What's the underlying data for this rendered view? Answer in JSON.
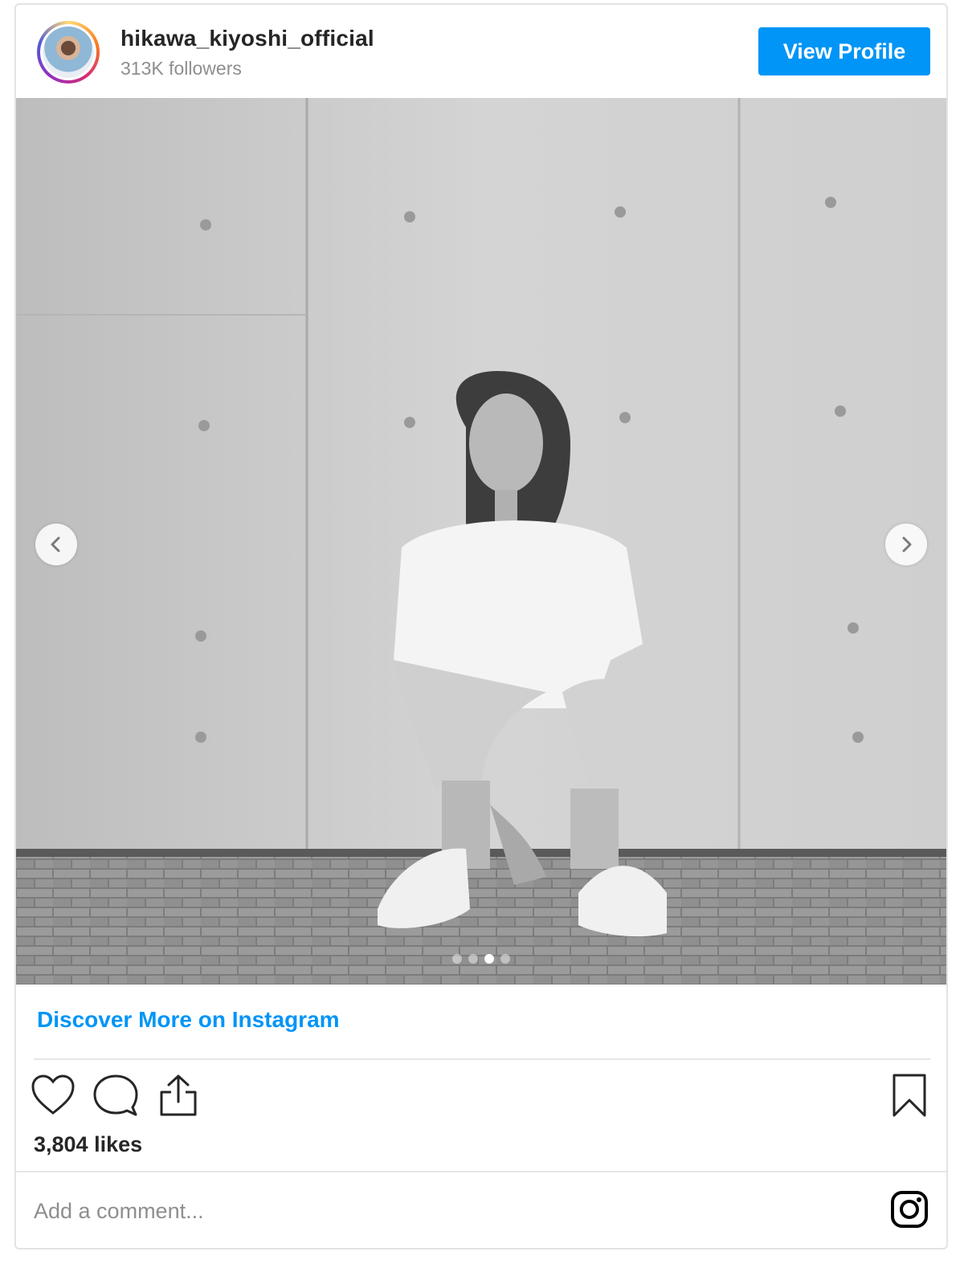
{
  "profile": {
    "username": "hikawa_kiyoshi_official",
    "followers": "313K followers",
    "view_profile_label": "View Profile"
  },
  "carousel": {
    "slide_count": 4,
    "active_index": 2
  },
  "discover_label": "Discover More on Instagram",
  "post": {
    "likes": "3,804 likes"
  },
  "comment": {
    "placeholder": "Add a comment..."
  },
  "icons": {
    "like": "heart-icon",
    "comment": "comment-bubble-icon",
    "share": "share-icon",
    "save": "bookmark-icon",
    "instagram": "instagram-logo-icon"
  },
  "colors": {
    "accent": "#0095f6",
    "text": "#262626",
    "muted": "#8e8e8e"
  }
}
